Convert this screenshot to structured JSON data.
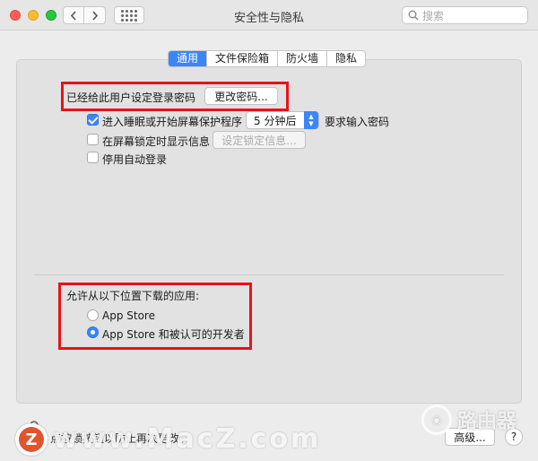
{
  "window": {
    "title": "安全性与隐私"
  },
  "toolbar": {
    "search_placeholder": "搜索"
  },
  "tabs": [
    {
      "label": "通用",
      "active": true
    },
    {
      "label": "文件保险箱",
      "active": false
    },
    {
      "label": "防火墙",
      "active": false
    },
    {
      "label": "隐私",
      "active": false
    }
  ],
  "general": {
    "password_label": "已经给此用户设定登录密码",
    "change_password_button": "更改密码...",
    "require_password_label": "进入睡眠或开始屏幕保护程序",
    "require_password_checked": true,
    "delay_value": "5 分钟后",
    "require_password_suffix": "要求输入密码",
    "show_message_label": "在屏幕锁定时显示信息",
    "show_message_checked": false,
    "set_lock_message_button": "设定锁定信息...",
    "disable_auto_login_label": "停用自动登录",
    "disable_auto_login_checked": false
  },
  "downloads": {
    "heading": "允许从以下位置下载的应用:",
    "options": [
      {
        "label": "App Store",
        "selected": false
      },
      {
        "label": "App Store 和被认可的开发者",
        "selected": true
      }
    ]
  },
  "footer": {
    "lock_text": "点按锁按钮以防止再次更改。",
    "advanced_button": "高级...",
    "help_button": "?"
  },
  "watermarks": {
    "site_text": "www.MacZ.com",
    "site_logo_letter": "Z",
    "router_text": "路由器"
  },
  "colors": {
    "accent": "#3b86f7",
    "highlight_box": "#e8131a"
  }
}
